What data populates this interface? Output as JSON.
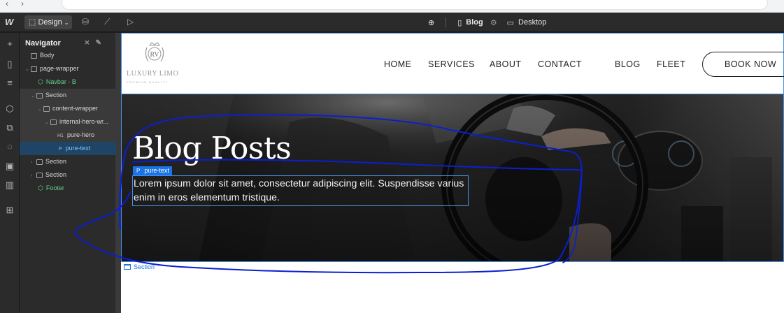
{
  "topbar": {
    "mode_label": "Design",
    "page_name": "Blog",
    "breakpoint": "Desktop"
  },
  "navigator": {
    "title": "Navigator",
    "tree": [
      {
        "label": "Body"
      },
      {
        "label": "page-wrapper"
      },
      {
        "label": "Navbar - B"
      },
      {
        "label": "Section"
      },
      {
        "label": "content-wrapper"
      },
      {
        "label": "internal-hero-wr..."
      },
      {
        "tag": "H1",
        "label": "pure-hero"
      },
      {
        "tag": "P",
        "label": "pure-text"
      },
      {
        "label": "Section"
      },
      {
        "label": "Section"
      },
      {
        "label": "Footer"
      }
    ]
  },
  "site": {
    "logo_monogram": "RV",
    "logo_wordmark": "LUXURY LIMO",
    "logo_tagline": "PREMIUM QUALITY",
    "menu": [
      "HOME",
      "SERVICES",
      "ABOUT",
      "CONTACT",
      "BLOG",
      "FLEET"
    ],
    "cta_label": "BOOK NOW",
    "hero_title": "Blog Posts",
    "hero_text": "Lorem ipsum dolor sit amet, consectetur adipiscing elit. Suspendisse varius enim in eros elementum tristique.",
    "selected_badge": {
      "tag": "P",
      "label": "pure-text"
    },
    "section_label": "Section"
  },
  "colors": {
    "selection_blue": "#1a73e8",
    "component_green": "#5fd38a",
    "scribble_blue": "#0b1fd1"
  }
}
